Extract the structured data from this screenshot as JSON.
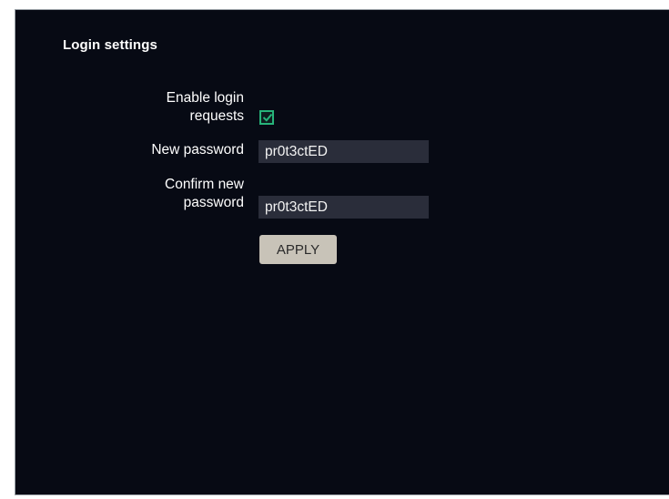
{
  "login_settings": {
    "title": "Login settings",
    "enable_login": {
      "label_line1": "Enable login",
      "label_line2": "requests",
      "checked": true
    },
    "new_password": {
      "label": "New password",
      "value": "pr0t3ctED"
    },
    "confirm_password": {
      "label_line1": "Confirm new",
      "label_line2": "password",
      "value": "pr0t3ctED"
    },
    "apply_label": "APPLY"
  },
  "colors": {
    "panel_bg": "#070a14",
    "input_bg": "#2a2d3a",
    "checkbox_accent": "#27b37a",
    "button_bg": "#c8c3b8"
  }
}
